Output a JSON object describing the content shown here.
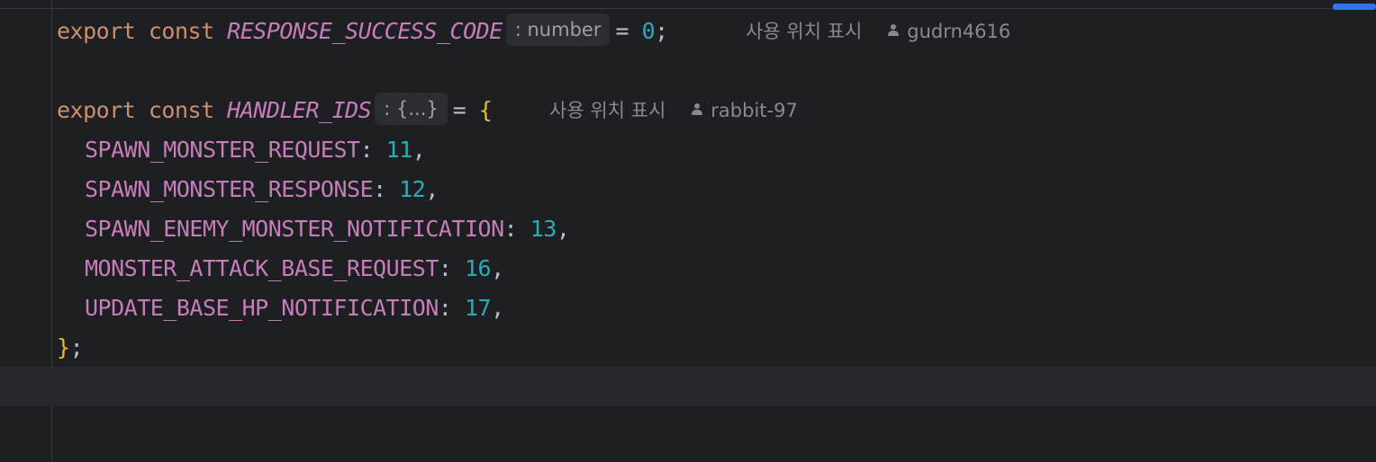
{
  "colors": {
    "background": "#1e1f22",
    "keyword": "#cf8e6d",
    "constant": "#c77dbb",
    "number": "#2aacb8",
    "brace": "#e8ba36",
    "hint_text": "#9da0a8",
    "accent": "#3574f0"
  },
  "lines": {
    "line1": {
      "keyword": "export const ",
      "name": "RESPONSE_SUCCESS_CODE",
      "type_hint": ": number",
      "assign": "= ",
      "value": "0",
      "end": ";",
      "usages": "사용 위치 표시",
      "author": "gudrn4616"
    },
    "line3": {
      "keyword": "export const ",
      "name": "HANDLER_IDS",
      "type_hint": ": {...}",
      "assign": "= ",
      "open": "{",
      "usages": "사용 위치 표시",
      "author": "rabbit-97"
    },
    "props": [
      {
        "key": "SPAWN_MONSTER_REQUEST",
        "value": "11"
      },
      {
        "key": "SPAWN_MONSTER_RESPONSE",
        "value": "12"
      },
      {
        "key": "SPAWN_ENEMY_MONSTER_NOTIFICATION",
        "value": "13"
      },
      {
        "key": "MONSTER_ATTACK_BASE_REQUEST",
        "value": "16"
      },
      {
        "key": "UPDATE_BASE_HP_NOTIFICATION",
        "value": "17"
      }
    ],
    "closing": {
      "brace": "}",
      "end": ";"
    },
    "separators": {
      "colon": ": ",
      "comma": ","
    }
  }
}
